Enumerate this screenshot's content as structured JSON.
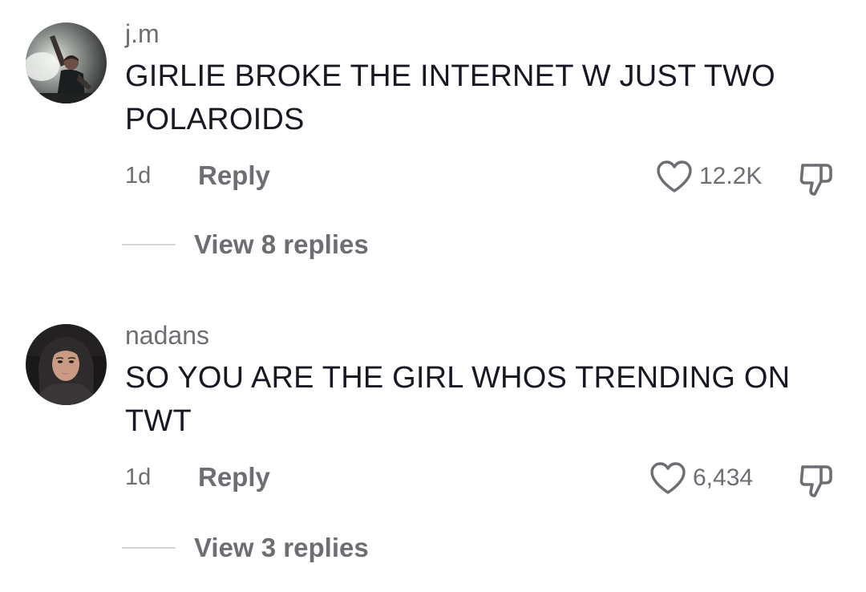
{
  "comments": [
    {
      "username": "j.m",
      "text": "GIRLIE BROKE THE INTERNET W JUST TWO POLAROIDS",
      "timestamp": "1d",
      "reply_label": "Reply",
      "like_count": "12.2K",
      "view_replies_label": "View 8 replies",
      "avatar_icon": "concert-performer-avatar",
      "liked": false
    },
    {
      "username": "nadans",
      "text": "SO YOU ARE THE GIRL WHOS TRENDING ON TWT",
      "timestamp": "1d",
      "reply_label": "Reply",
      "like_count": "6,434",
      "view_replies_label": "View 3 replies",
      "avatar_icon": "woman-portrait-avatar",
      "liked": false
    }
  ],
  "colors": {
    "text_primary": "#161823",
    "text_secondary": "#6d6e73",
    "divider": "#d6d7da",
    "background": "#ffffff"
  }
}
